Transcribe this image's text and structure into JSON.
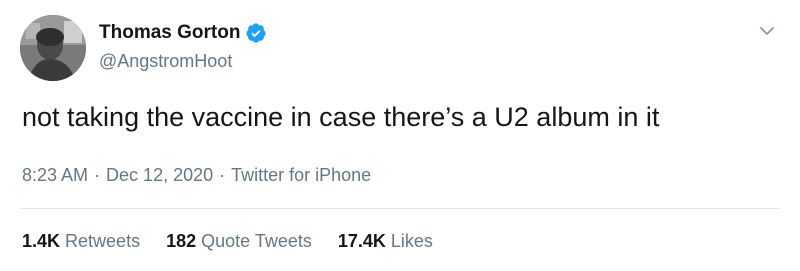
{
  "author": {
    "name": "Thomas Gorton",
    "handle": "@AngstromHoot",
    "verified": true,
    "verified_color": "#1da1f2"
  },
  "tweet": {
    "text": "not taking the vaccine in case there’s a U2 album in it"
  },
  "meta": {
    "time": "8:23 AM",
    "separator1": "·",
    "date": "Dec 12, 2020",
    "separator2": "·",
    "source": "Twitter for iPhone"
  },
  "stats": {
    "retweets": {
      "count": "1.4K",
      "label": "Retweets"
    },
    "quote_tweets": {
      "count": "182",
      "label": "Quote Tweets"
    },
    "likes": {
      "count": "17.4K",
      "label": "Likes"
    }
  },
  "icons": {
    "verified": "verified-badge-icon",
    "menu": "chevron-down-icon"
  },
  "colors": {
    "text_primary": "#14171a",
    "text_secondary": "#657786",
    "divider": "#e1e8ed"
  }
}
